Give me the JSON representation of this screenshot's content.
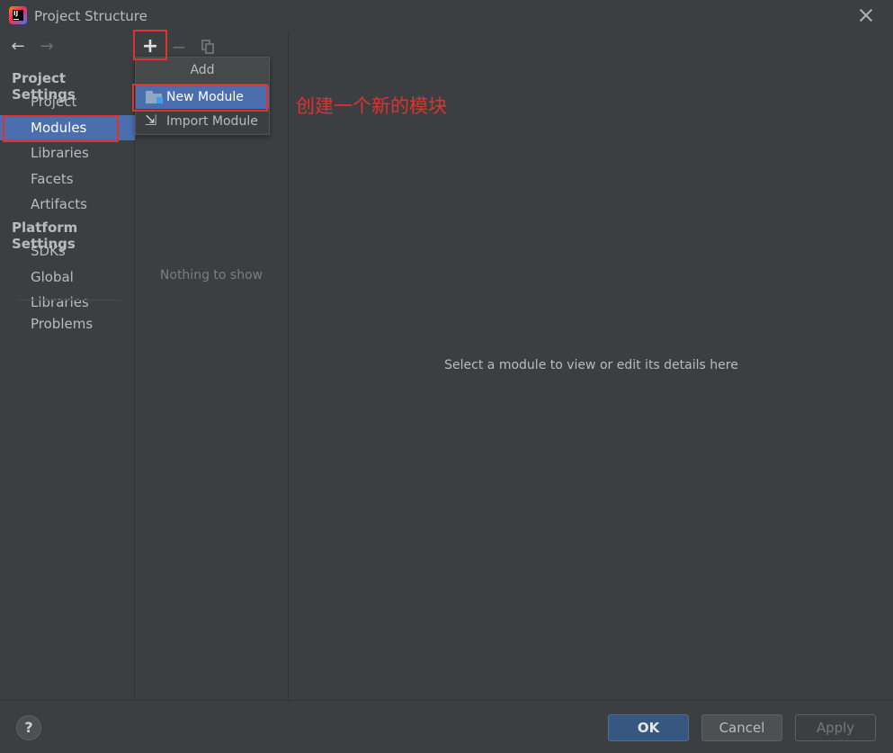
{
  "window": {
    "title": "Project Structure",
    "app_icon": "intellij-idea-icon",
    "close_icon": "close-icon"
  },
  "sidebar": {
    "nav": {
      "back_icon": "arrow-left-icon",
      "back_glyph": "←",
      "forward_icon": "arrow-right-icon",
      "forward_glyph": "→"
    },
    "project_settings_header": "Project Settings",
    "project_items": [
      {
        "label": "Project",
        "selected": false
      },
      {
        "label": "Modules",
        "selected": true
      },
      {
        "label": "Libraries",
        "selected": false
      },
      {
        "label": "Facets",
        "selected": false
      },
      {
        "label": "Artifacts",
        "selected": false
      }
    ],
    "platform_settings_header": "Platform Settings",
    "platform_items": [
      {
        "label": "SDKs",
        "selected": false
      },
      {
        "label": "Global Libraries",
        "selected": false
      }
    ],
    "problems_label": "Problems"
  },
  "middle": {
    "toolbar": {
      "add_glyph": "+",
      "remove_glyph": "−",
      "add_icon": "plus-icon",
      "remove_icon": "minus-icon",
      "copy_icon": "copy-icon"
    },
    "empty_text": "Nothing to show"
  },
  "add_popup": {
    "title": "Add",
    "items": [
      {
        "label": "New Module",
        "icon": "module-folder-icon",
        "selected": true
      },
      {
        "label": "Import Module",
        "icon": "import-icon",
        "glyph": "⇲",
        "selected": false
      }
    ]
  },
  "annotation": {
    "text": "创建一个新的模块",
    "color": "#e0312f"
  },
  "main": {
    "placeholder_text": "Select a module to view or edit its details here"
  },
  "footer": {
    "help_glyph": "?",
    "ok_label": "OK",
    "cancel_label": "Cancel",
    "apply_label": "Apply"
  },
  "colors": {
    "background": "#3c3f41",
    "selection": "#4b6eaf",
    "highlight_box": "#e0312f",
    "ok_button": "#365880"
  }
}
